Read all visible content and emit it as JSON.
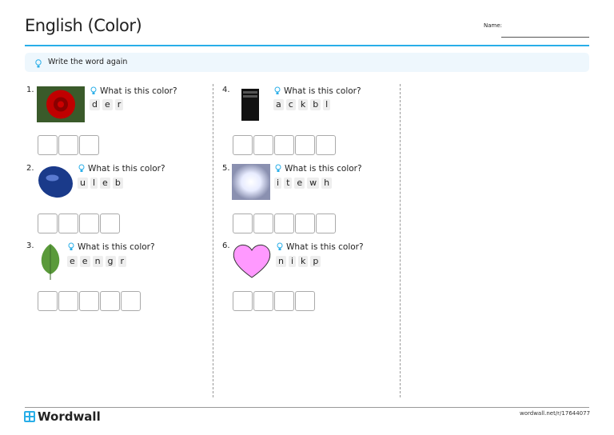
{
  "title": "English (Color)",
  "name_label": "Name:",
  "instruction": "Write the word again",
  "items": [
    {
      "number": "1.",
      "prompt": "What is this color?",
      "letters": [
        "d",
        "e",
        "r"
      ],
      "box_count": 3,
      "image": "red-rose",
      "accent": "#c00000"
    },
    {
      "number": "2.",
      "prompt": "What is this color?",
      "letters": [
        "u",
        "l",
        "e",
        "b"
      ],
      "box_count": 4,
      "image": "blue-stone",
      "accent": "#1a3a8a"
    },
    {
      "number": "3.",
      "prompt": "What is this color?",
      "letters": [
        "e",
        "e",
        "n",
        "g",
        "r"
      ],
      "box_count": 5,
      "image": "green-leaf",
      "accent": "#5a9a3a"
    },
    {
      "number": "4.",
      "prompt": "What is this color?",
      "letters": [
        "a",
        "c",
        "k",
        "b",
        "l"
      ],
      "box_count": 5,
      "image": "black-computer",
      "accent": "#111111"
    },
    {
      "number": "5.",
      "prompt": "What is this color?",
      "letters": [
        "i",
        "t",
        "e",
        "w",
        "h"
      ],
      "box_count": 5,
      "image": "white-light",
      "accent": "#ffffff"
    },
    {
      "number": "6.",
      "prompt": "What is this color?",
      "letters": [
        "n",
        "i",
        "k",
        "p"
      ],
      "box_count": 4,
      "image": "pink-heart",
      "accent": "#ff99ff"
    }
  ],
  "footer": {
    "logo": "Wordwall",
    "url": "wordwall.net/r/17644077"
  }
}
